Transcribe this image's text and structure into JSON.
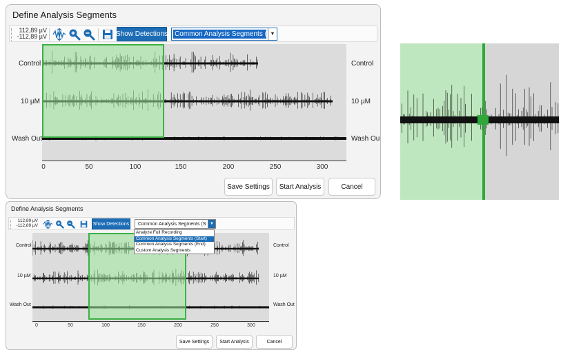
{
  "dialog": {
    "title": "Define Analysis Segments",
    "scale_top": "112,89 µV",
    "scale_bottom": "-112,89 µV",
    "show_detections": "Show Detections",
    "combo_value": "Common Analysis Segments (Sta",
    "channels": [
      "Control",
      "10 µM",
      "Wash Out"
    ],
    "x_ticks": [
      "0",
      "50",
      "100",
      "150",
      "200",
      "250",
      "300"
    ],
    "save_settings": "Save Settings",
    "start_analysis": "Start Analysis",
    "cancel": "Cancel"
  },
  "dropdown_options": [
    "Analyze Full Recording",
    "Common Analysis Segments (Start)",
    "Common Analysis Segments (End)",
    "Custom Analysis Segments"
  ],
  "dropdown_selected_index": 1,
  "colors": {
    "accent": "#1c6db5",
    "segment_fill": "#c8eec8",
    "segment_border": "#3cb043",
    "trace": "#111111"
  }
}
